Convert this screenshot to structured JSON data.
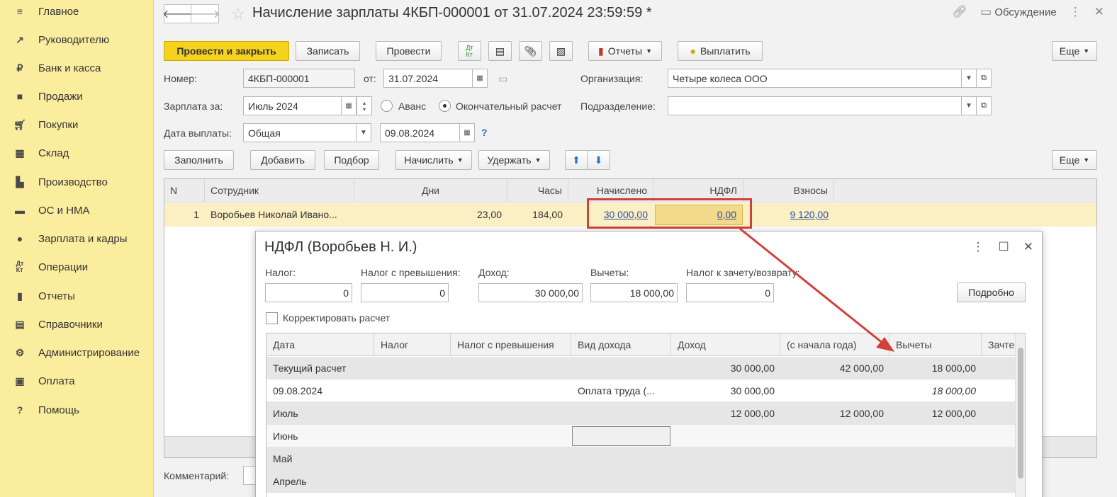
{
  "sidebar": {
    "items": [
      {
        "icon": "menu-icon",
        "glyph": "≡",
        "label": "Главное"
      },
      {
        "icon": "trend-icon",
        "glyph": "↗",
        "label": "Руководителю"
      },
      {
        "icon": "coin-icon",
        "glyph": "₽",
        "label": "Банк и касса"
      },
      {
        "icon": "bag-icon",
        "glyph": "▣",
        "label": "Продажи"
      },
      {
        "icon": "cart-icon",
        "glyph": "⛟",
        "label": "Покупки"
      },
      {
        "icon": "warehouse-icon",
        "glyph": "▦",
        "label": "Склад"
      },
      {
        "icon": "factory-icon",
        "glyph": "⌂",
        "label": "Производство"
      },
      {
        "icon": "truck-icon",
        "glyph": "⛟",
        "label": "ОС и НМА"
      },
      {
        "icon": "person-icon",
        "glyph": "●",
        "label": "Зарплата и кадры"
      },
      {
        "icon": "dt-kt-icon",
        "glyph": "ᴰᵗ",
        "label": "Операции"
      },
      {
        "icon": "bar-chart-icon",
        "glyph": "▮",
        "label": "Отчеты"
      },
      {
        "icon": "books-icon",
        "glyph": "▤",
        "label": "Справочники"
      },
      {
        "icon": "gear-icon",
        "glyph": "⚙",
        "label": "Администрирование"
      },
      {
        "icon": "wallet-icon",
        "glyph": "▣",
        "label": "Оплата"
      },
      {
        "icon": "help-icon",
        "glyph": "?",
        "label": "Помощь"
      }
    ]
  },
  "header": {
    "title": "Начисление зарплаты 4КБП-000001 от 31.07.2024 23:59:59 *",
    "discuss": "Обсуждение"
  },
  "toolbar": {
    "post_close": "Провести и закрыть",
    "save": "Записать",
    "post": "Провести",
    "reports": "Отчеты",
    "pay": "Выплатить",
    "more": "Еще"
  },
  "form": {
    "number_label": "Номер:",
    "number": "4КБП-000001",
    "from_label": "от:",
    "date": "31.07.2024",
    "org_label": "Организация:",
    "org": "Четыре колеса ООО",
    "salary_for_label": "Зарплата за:",
    "salary_for": "Июль 2024",
    "advance": "Аванс",
    "final": "Окончательный расчет",
    "dept_label": "Подразделение:",
    "dept": "",
    "pay_date_label": "Дата выплаты:",
    "pay_type": "Общая",
    "pay_date": "09.08.2024",
    "help": "?",
    "comment_label": "Комментарий:"
  },
  "table_toolbar": {
    "fill": "Заполнить",
    "add": "Добавить",
    "pick": "Подбор",
    "accrue": "Начислить",
    "withhold": "Удержать",
    "more": "Еще"
  },
  "main_table": {
    "columns": [
      "N",
      "Сотрудник",
      "Дни",
      "Часы",
      "Начислено",
      "НДФЛ",
      "Взносы"
    ],
    "rows": [
      {
        "n": "1",
        "employee": "Воробьев Николай Ивано...",
        "days": "23,00",
        "hours": "184,00",
        "accrued": "30 000,00",
        "ndfl": "0,00",
        "contrib": "9 120,00"
      }
    ]
  },
  "dialog": {
    "title": "НДФЛ (Воробьев Н. И.)",
    "tax_label": "Налог:",
    "tax": "0",
    "tax_excess_label": "Налог с превышения:",
    "tax_excess": "0",
    "income_label": "Доход:",
    "income": "30 000,00",
    "deductions_label": "Вычеты:",
    "deductions": "18 000,00",
    "offset_label": "Налог к зачету/возврату:",
    "offset": "0",
    "details": "Подробно",
    "correct_label": "Корректировать расчет",
    "columns": [
      "Дата",
      "Налог",
      "Налог с превышения",
      "Вид дохода",
      "Доход",
      "(с начала года)",
      "Вычеты",
      "Зачте"
    ],
    "rows": [
      {
        "date": "Текущий расчет",
        "tax": "",
        "excess": "",
        "kind": "",
        "income": "30 000,00",
        "ytd": "42 000,00",
        "ded": "18 000,00"
      },
      {
        "date": "09.08.2024",
        "tax": "",
        "excess": "",
        "kind": "Оплата труда (...",
        "income": "30 000,00",
        "ytd": "",
        "ded": "18 000,00"
      },
      {
        "date": "Июль",
        "tax": "",
        "excess": "",
        "kind": "",
        "income": "12 000,00",
        "ytd": "12 000,00",
        "ded": "12 000,00"
      },
      {
        "date": "Июнь",
        "tax": "",
        "excess": "",
        "kind": "",
        "income": "",
        "ytd": "",
        "ded": ""
      },
      {
        "date": "Май",
        "tax": "",
        "excess": "",
        "kind": "",
        "income": "",
        "ytd": "",
        "ded": ""
      },
      {
        "date": "Апрель",
        "tax": "",
        "excess": "",
        "kind": "",
        "income": "",
        "ytd": "",
        "ded": ""
      }
    ]
  },
  "colors": {
    "sidebar_bg": "#fbed9e",
    "primary_button": "#f5d21e",
    "selected_row": "#fbefc4",
    "annotation": "#d2403a",
    "link": "#2a4fa8"
  }
}
